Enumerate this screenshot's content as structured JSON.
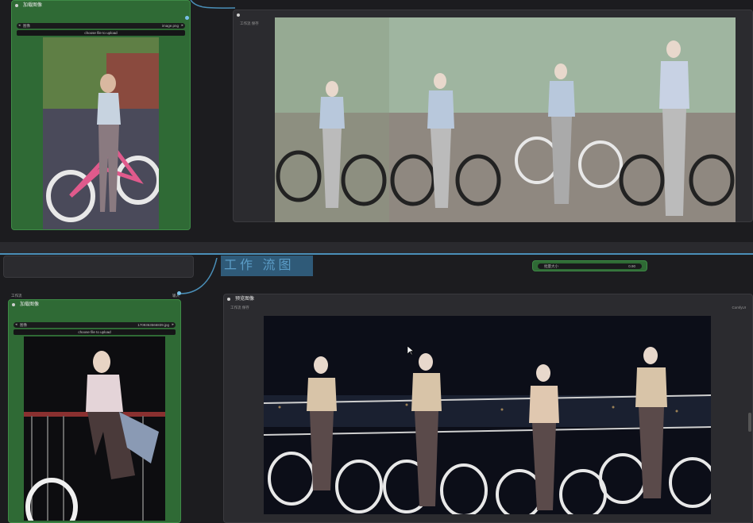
{
  "top": {
    "load_node": {
      "title": "加载图像",
      "widget_label": "图像",
      "widget_value": "image.png",
      "upload_label": "choose file to upload"
    },
    "preview_node": {
      "title": "",
      "sub_label": "工作流 保存"
    }
  },
  "bottom": {
    "floating_title": "工作 流图",
    "small_widget": {
      "label": "批量大小",
      "value": "0.90"
    },
    "left_label_a": "工作流",
    "left_label_b": "输入",
    "load_node": {
      "title": "加载图像",
      "widget_label": "图像",
      "widget_value": "1709363566839.jpg",
      "upload_label": "choose file to upload"
    },
    "preview_node": {
      "title": "预览图像",
      "sub_label": "工作流 保存",
      "sub_right": "ComfyUI"
    }
  },
  "colors": {
    "node_green": "#2f6a35",
    "node_dark": "#2b2b2f",
    "link_blue": "#4a8fb8"
  },
  "icons": [
    "node-collapse-dot",
    "arrow-left-icon",
    "arrow-right-icon",
    "cursor-icon"
  ]
}
